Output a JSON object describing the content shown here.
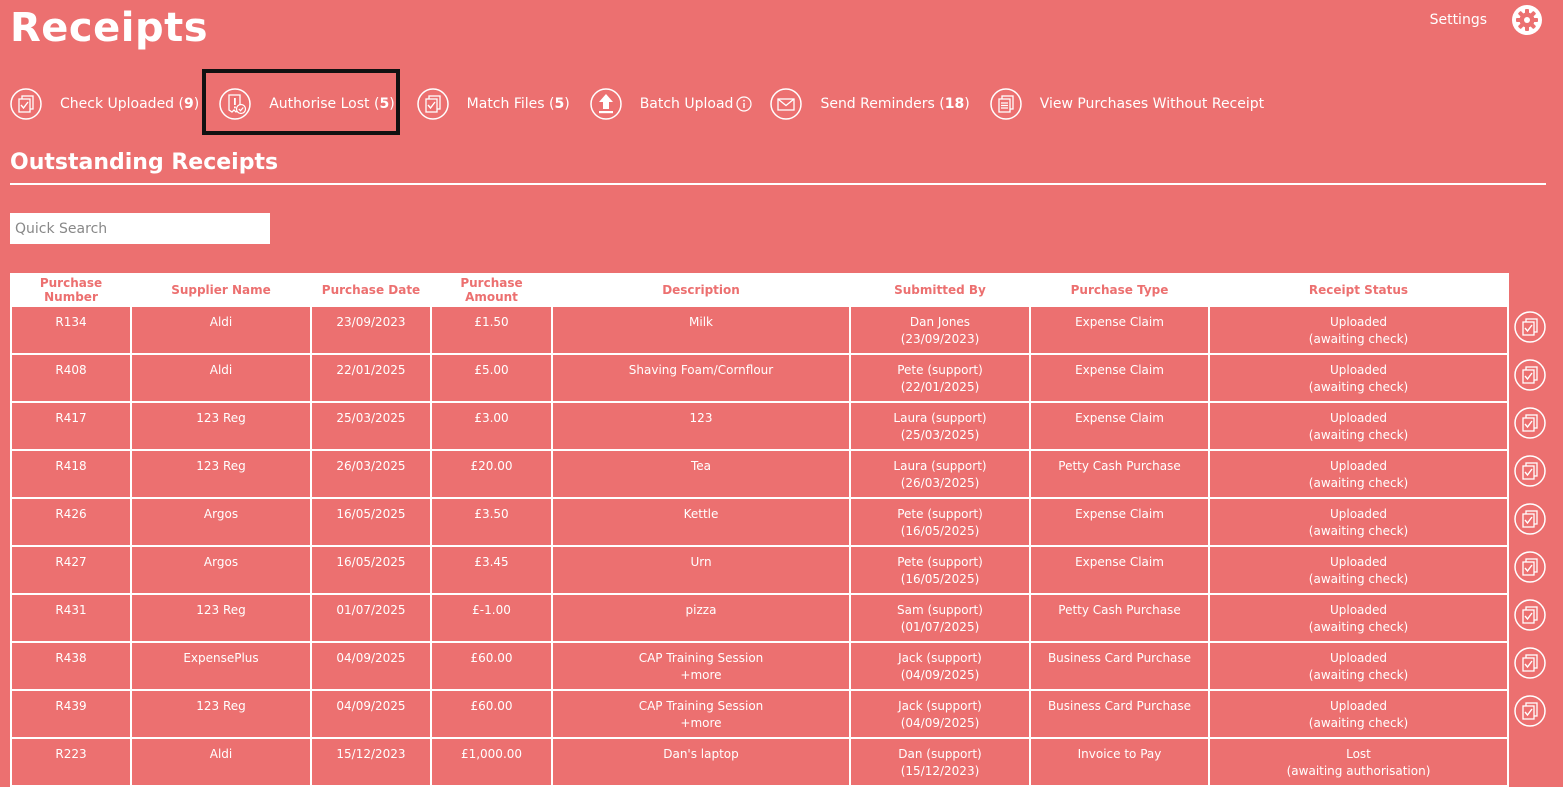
{
  "app": {
    "title": "Receipts",
    "settings_label": "Settings"
  },
  "toolbar": {
    "items": [
      {
        "label": "Check Uploaded",
        "count": "9",
        "icon": "check-document-icon"
      },
      {
        "label": "Authorise Lost",
        "count": "5",
        "icon": "authorise-lost-icon"
      },
      {
        "label": "Match Files",
        "count": "5",
        "icon": "match-files-icon"
      },
      {
        "label": "Batch Upload",
        "count": "",
        "icon": "upload-icon"
      },
      {
        "label": "Send Reminders",
        "count": "18",
        "icon": "envelope-icon"
      },
      {
        "label": "View Purchases Without Receipt",
        "count": "",
        "icon": "document-list-icon"
      }
    ]
  },
  "section": {
    "title": "Outstanding Receipts"
  },
  "search": {
    "placeholder": "Quick Search",
    "value": ""
  },
  "table": {
    "columns": [
      "Purchase Number",
      "Supplier Name",
      "Purchase Date",
      "Purchase Amount",
      "Description",
      "Submitted By",
      "Purchase Type",
      "Receipt Status"
    ],
    "rows": [
      {
        "number": "R134",
        "supplier": "Aldi",
        "date": "23/09/2023",
        "amount": "£1.50",
        "desc1": "Milk",
        "desc2": "",
        "submitter": "Dan Jones",
        "submitted_date": "(23/09/2023)",
        "type": "Expense Claim",
        "status1": "Uploaded",
        "status2": "(awaiting check)"
      },
      {
        "number": "R408",
        "supplier": "Aldi",
        "date": "22/01/2025",
        "amount": "£5.00",
        "desc1": "Shaving Foam/Cornflour",
        "desc2": "",
        "submitter": "Pete (support)",
        "submitted_date": "(22/01/2025)",
        "type": "Expense Claim",
        "status1": "Uploaded",
        "status2": "(awaiting check)"
      },
      {
        "number": "R417",
        "supplier": "123 Reg",
        "date": "25/03/2025",
        "amount": "£3.00",
        "desc1": "123",
        "desc2": "",
        "submitter": "Laura (support)",
        "submitted_date": "(25/03/2025)",
        "type": "Expense Claim",
        "status1": "Uploaded",
        "status2": "(awaiting check)"
      },
      {
        "number": "R418",
        "supplier": "123 Reg",
        "date": "26/03/2025",
        "amount": "£20.00",
        "desc1": "Tea",
        "desc2": "",
        "submitter": "Laura (support)",
        "submitted_date": "(26/03/2025)",
        "type": "Petty Cash Purchase",
        "status1": "Uploaded",
        "status2": "(awaiting check)"
      },
      {
        "number": "R426",
        "supplier": "Argos",
        "date": "16/05/2025",
        "amount": "£3.50",
        "desc1": "Kettle",
        "desc2": "",
        "submitter": "Pete (support)",
        "submitted_date": "(16/05/2025)",
        "type": "Expense Claim",
        "status1": "Uploaded",
        "status2": "(awaiting check)"
      },
      {
        "number": "R427",
        "supplier": "Argos",
        "date": "16/05/2025",
        "amount": "£3.45",
        "desc1": "Urn",
        "desc2": "",
        "submitter": "Pete (support)",
        "submitted_date": "(16/05/2025)",
        "type": "Expense Claim",
        "status1": "Uploaded",
        "status2": "(awaiting check)"
      },
      {
        "number": "R431",
        "supplier": "123 Reg",
        "date": "01/07/2025",
        "amount": "£-1.00",
        "desc1": "pizza",
        "desc2": "",
        "submitter": "Sam (support)",
        "submitted_date": "(01/07/2025)",
        "type": "Petty Cash Purchase",
        "status1": "Uploaded",
        "status2": "(awaiting check)"
      },
      {
        "number": "R438",
        "supplier": "ExpensePlus",
        "date": "04/09/2025",
        "amount": "£60.00",
        "desc1": "CAP Training Session",
        "desc2": "+more",
        "submitter": "Jack (support)",
        "submitted_date": "(04/09/2025)",
        "type": "Business Card Purchase",
        "status1": "Uploaded",
        "status2": "(awaiting check)"
      },
      {
        "number": "R439",
        "supplier": "123 Reg",
        "date": "04/09/2025",
        "amount": "£60.00",
        "desc1": "CAP Training Session",
        "desc2": "+more",
        "submitter": "Jack (support)",
        "submitted_date": "(04/09/2025)",
        "type": "Business Card Purchase",
        "status1": "Uploaded",
        "status2": "(awaiting check)"
      },
      {
        "number": "R223",
        "supplier": "Aldi",
        "date": "15/12/2023",
        "amount": "£1,000.00",
        "desc1": "Dan's laptop",
        "desc2": "",
        "submitter": "Dan (support)",
        "submitted_date": "(15/12/2023)",
        "type": "Invoice to Pay",
        "status1": "Lost",
        "status2": "(awaiting authorisation)"
      }
    ]
  },
  "colors": {
    "background": "#ec7070",
    "foreground": "#ffffff",
    "highlight_border": "#111111"
  }
}
